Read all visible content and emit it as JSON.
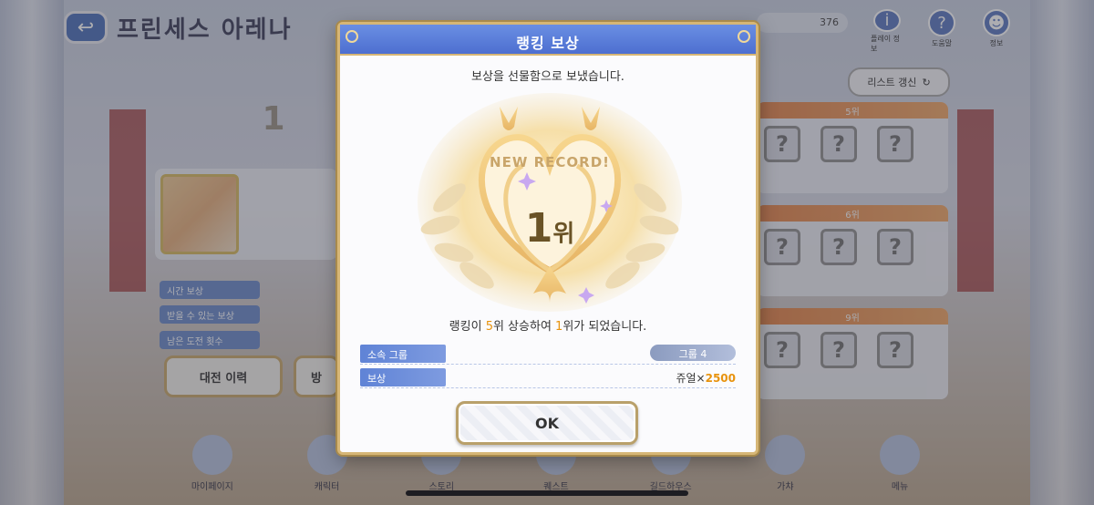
{
  "background": {
    "title": "프린세스 아레나",
    "coins": "376",
    "top_icons": [
      {
        "name": "info-icon",
        "glyph": "i",
        "label": "플레이 정보"
      },
      {
        "name": "help-icon",
        "glyph": "?",
        "label": "도움말"
      },
      {
        "name": "profile-icon",
        "glyph": "☻",
        "label": "정보"
      }
    ],
    "refresh_label": "리스트 갱신",
    "left_buttons": [
      "대전 이력",
      "방"
    ],
    "stat_rows": [
      "시간 보상",
      "받을 수 있는 보상",
      "남은 도전 횟수"
    ],
    "rivals": [
      "5위",
      "6위",
      "9위"
    ],
    "nav": [
      "마이페이지",
      "캐릭터",
      "스토리",
      "퀘스트",
      "길드하우스",
      "가챠",
      "메뉴"
    ]
  },
  "modal": {
    "title": "랭킹 보상",
    "subtitle": "보상을 선물함으로 보냈습니다.",
    "emblem_text": "NEW RECORD!",
    "emblem_rank_num": "1",
    "emblem_rank_unit": "위",
    "message": {
      "pre": "랭킹이 ",
      "up": "5",
      "mid": "위 상승하여 ",
      "rank": "1",
      "post": "위가 되었습니다."
    },
    "group_label": "소속 그룹",
    "group_value": "그룹 4",
    "reward_label": "보상",
    "reward_item": "쥬얼×",
    "reward_qty": "2500",
    "ok_label": "OK"
  },
  "colors": {
    "header_blue": "#5a7fd9",
    "highlight": "#e8930e",
    "gold": "#d6b676"
  }
}
